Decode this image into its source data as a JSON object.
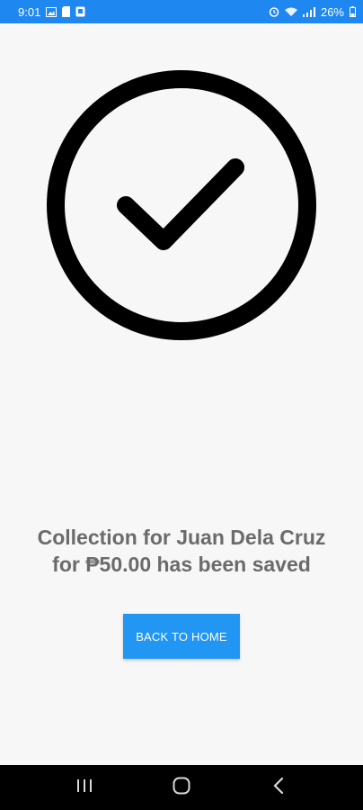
{
  "status_bar": {
    "time": "9:01",
    "battery": "26%",
    "left_icons": [
      "image-icon",
      "sd-card-icon",
      "app-notification-icon"
    ],
    "right_icons": [
      "alarm-icon",
      "wifi-icon",
      "signal-icon",
      "battery-icon"
    ],
    "color": "#1f87f0"
  },
  "success": {
    "icon": "check-circle-icon",
    "message": "Collection for Juan Dela Cruz for ₱50.00 has been saved"
  },
  "actions": {
    "back_home_label": "BACK TO HOME",
    "accent": "#2196f3"
  },
  "nav_bar": {
    "buttons": [
      "recent-apps-icon",
      "home-icon",
      "back-icon"
    ]
  }
}
